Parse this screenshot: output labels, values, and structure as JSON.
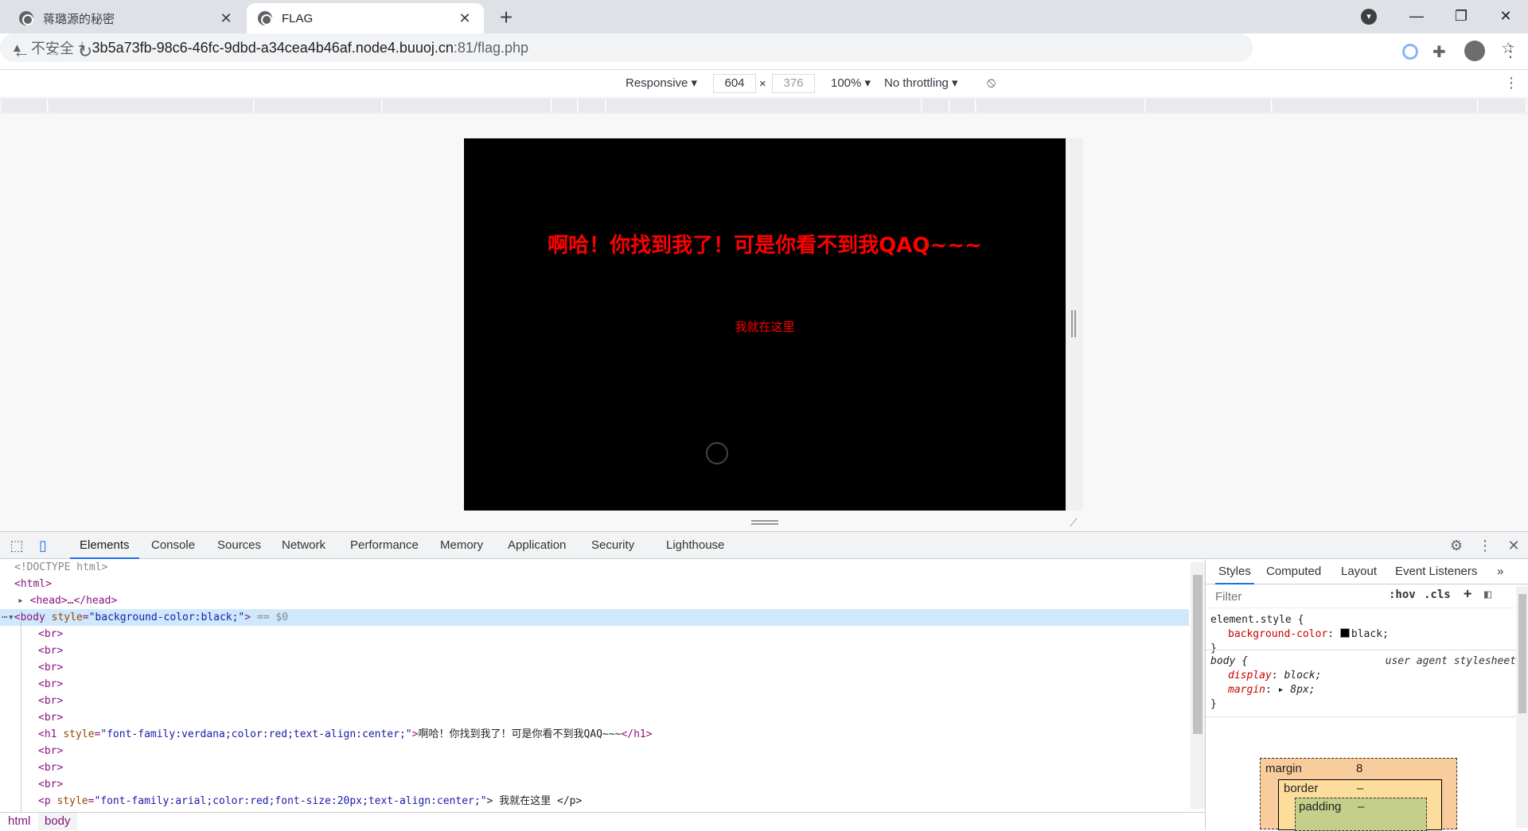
{
  "browser": {
    "tabs": [
      {
        "title": "蒋璐源的秘密",
        "close": "✕"
      },
      {
        "title": "FLAG",
        "close": "✕"
      }
    ],
    "new_tab": "+",
    "window": {
      "minimize": "—",
      "restore": "❐",
      "close": "✕"
    },
    "nav": {
      "back": "←",
      "forward": "→",
      "reload": "↻"
    },
    "address": {
      "insecure_label": "不安全",
      "separator": "|",
      "host": "3b5a73fb-98c6-46fc-9dbd-a34cea4b46af.node4.buuoj.cn",
      "path": ":81/flag.php"
    }
  },
  "device_toolbar": {
    "device": "Responsive ▾",
    "width": "604",
    "times": "×",
    "height": "376",
    "zoom": "100% ▾",
    "throttle": "No throttling ▾"
  },
  "page": {
    "heading": "啊哈！你找到我了！可是你看不到我QAQ~~~",
    "paragraph": "我就在这里"
  },
  "devtools": {
    "tabs": [
      "Elements",
      "Console",
      "Sources",
      "Network",
      "Performance",
      "Memory",
      "Application",
      "Security",
      "Lighthouse"
    ],
    "dom": {
      "doctype": "<!DOCTYPE html>",
      "html_open": "<html>",
      "head": "<head>…</head>",
      "body_tag": "<body ",
      "body_attr_name": "style",
      "body_attr_val": "\"background-color:black;\"",
      "body_close": ">",
      "body_marker": " == $0",
      "br": "<br>",
      "h1_open": "<h1 ",
      "h1_attr_name": "style",
      "h1_attr_val": "\"font-family:verdana;color:red;text-align:center;\"",
      "h1_gt": ">",
      "h1_text": "啊哈！你找到我了！可是你看不到我QAQ~~~",
      "h1_close": "</h1>",
      "p_open": "<p ",
      "p_attr_name": "style",
      "p_attr_val": "\"font-family:arial;color:red;font-size:20px;text-align:center;\"",
      "p_text": "> 我就在这里 </p>"
    },
    "breadcrumbs": [
      "html",
      "body"
    ],
    "styles": {
      "tabs": [
        "Styles",
        "Computed",
        "Layout",
        "Event Listeners",
        "»"
      ],
      "filter_placeholder": "Filter",
      "hov": ":hov",
      "cls": ".cls",
      "plus": "+",
      "element_style_selector": "element.style {",
      "element_style_prop": "background-color",
      "element_style_val": "black;",
      "close_brace": "}",
      "body_selector": "body {",
      "ua_label": "user agent stylesheet",
      "display_prop": "display",
      "display_val": "block;",
      "margin_prop": "margin",
      "margin_val": "▸ 8px;"
    },
    "box_model": {
      "margin_label": "margin",
      "margin_value": "8",
      "border_label": "border",
      "border_value": "–",
      "padding_label": "padding",
      "padding_value": "–"
    }
  }
}
